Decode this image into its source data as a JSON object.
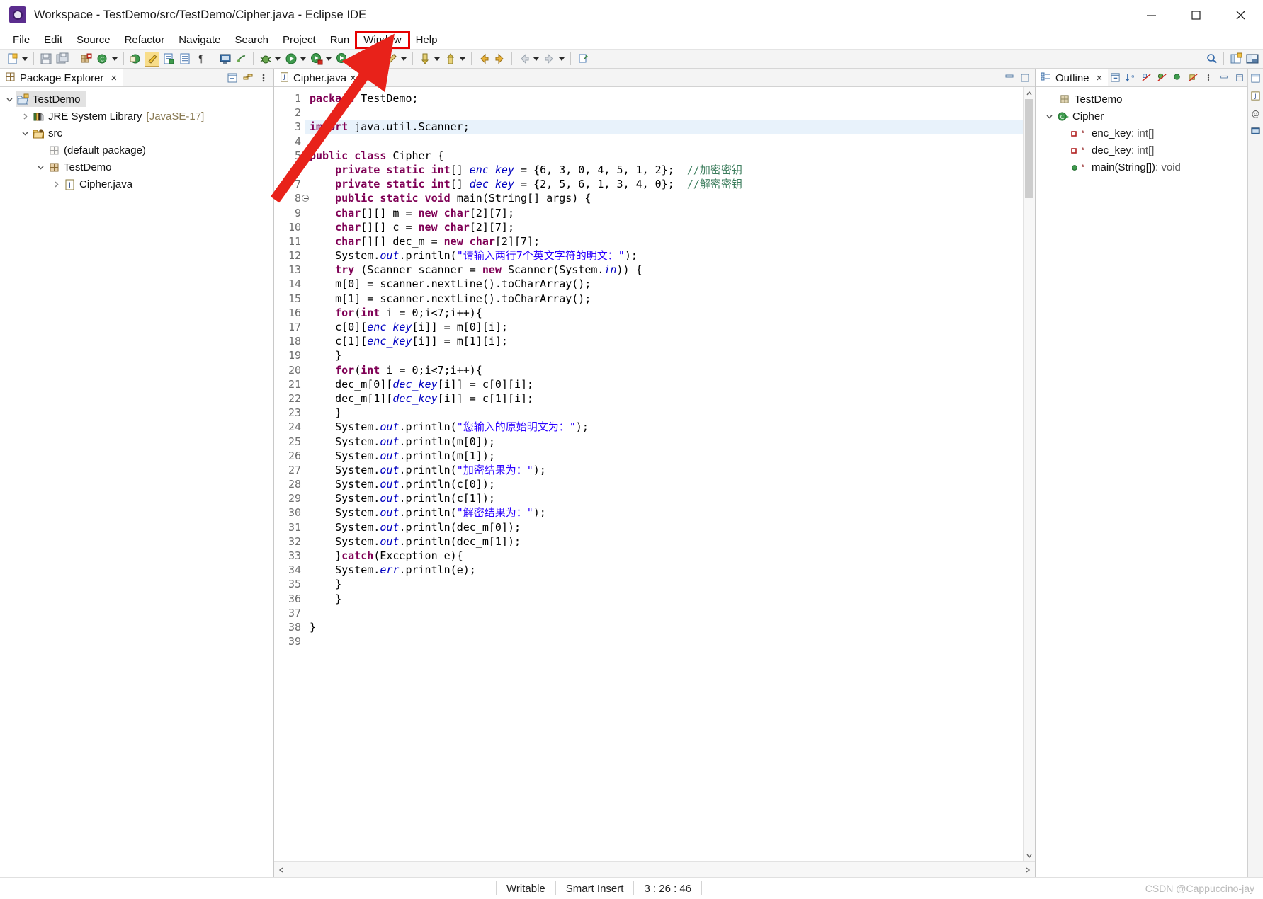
{
  "window": {
    "title": "Workspace - TestDemo/src/TestDemo/Cipher.java - Eclipse IDE",
    "app_icon": "eclipse-icon",
    "minimize": "minimize-button",
    "maximize": "maximize-button",
    "close": "close-button"
  },
  "menubar": {
    "items": [
      {
        "label": "File"
      },
      {
        "label": "Edit"
      },
      {
        "label": "Source"
      },
      {
        "label": "Refactor"
      },
      {
        "label": "Navigate"
      },
      {
        "label": "Search"
      },
      {
        "label": "Project"
      },
      {
        "label": "Run"
      },
      {
        "label": "Window",
        "highlighted": true
      },
      {
        "label": "Help"
      }
    ],
    "highlight_color": "#e60000"
  },
  "package_explorer": {
    "tab_label": "Package Explorer",
    "close_glyph": "×",
    "tree": [
      {
        "label": "TestDemo",
        "icon": "java-project-icon",
        "depth": 0,
        "twisty": "down",
        "selected": true
      },
      {
        "label": "JRE System Library",
        "suffix": "[JavaSE-17]",
        "icon": "library-icon",
        "depth": 1,
        "twisty": "right"
      },
      {
        "label": "src",
        "icon": "source-folder-icon",
        "depth": 1,
        "twisty": "down"
      },
      {
        "label": "(default package)",
        "icon": "package-icon",
        "depth": 2,
        "twisty": "none"
      },
      {
        "label": "TestDemo",
        "icon": "package-icon",
        "depth": 2,
        "twisty": "down"
      },
      {
        "label": "Cipher.java",
        "icon": "java-file-icon",
        "depth": 3,
        "twisty": "right"
      }
    ]
  },
  "editor": {
    "tab_label": "Cipher.java",
    "tab_icon": "java-file-icon",
    "close_glyph": "×",
    "first_line": 1,
    "total_lines": 39,
    "cursor_line": 3,
    "fold_markers": [
      8
    ],
    "lines": [
      {
        "n": 1,
        "tokens": [
          {
            "t": "kw",
            "v": "package"
          },
          {
            "t": "p",
            "v": " TestDemo;"
          }
        ]
      },
      {
        "n": 2,
        "tokens": []
      },
      {
        "n": 3,
        "highlight": true,
        "tokens": [
          {
            "t": "kw",
            "v": "import"
          },
          {
            "t": "p",
            "v": " java.util.Scanner;"
          },
          {
            "t": "caret",
            "v": ""
          }
        ]
      },
      {
        "n": 4,
        "tokens": []
      },
      {
        "n": 5,
        "tokens": [
          {
            "t": "kw",
            "v": "public class"
          },
          {
            "t": "p",
            "v": " Cipher {"
          }
        ]
      },
      {
        "n": 6,
        "tokens": [
          {
            "t": "p",
            "v": "    "
          },
          {
            "t": "kw",
            "v": "private static int"
          },
          {
            "t": "p",
            "v": "[] "
          },
          {
            "t": "fld",
            "v": "enc_key"
          },
          {
            "t": "p",
            "v": " = {6, 3, 0, 4, 5, 1, 2};  "
          },
          {
            "t": "cmt",
            "v": "//加密密钥"
          }
        ]
      },
      {
        "n": 7,
        "tokens": [
          {
            "t": "p",
            "v": "    "
          },
          {
            "t": "kw",
            "v": "private static int"
          },
          {
            "t": "p",
            "v": "[] "
          },
          {
            "t": "fld",
            "v": "dec_key"
          },
          {
            "t": "p",
            "v": " = {2, 5, 6, 1, 3, 4, 0};  "
          },
          {
            "t": "cmt",
            "v": "//解密密钥"
          }
        ]
      },
      {
        "n": 8,
        "tokens": [
          {
            "t": "p",
            "v": "    "
          },
          {
            "t": "kw",
            "v": "public static void"
          },
          {
            "t": "p",
            "v": " main(String[] args) {"
          }
        ]
      },
      {
        "n": 9,
        "tokens": [
          {
            "t": "p",
            "v": "    "
          },
          {
            "t": "kw",
            "v": "char"
          },
          {
            "t": "p",
            "v": "[][] m = "
          },
          {
            "t": "kw",
            "v": "new char"
          },
          {
            "t": "p",
            "v": "[2][7];"
          }
        ]
      },
      {
        "n": 10,
        "tokens": [
          {
            "t": "p",
            "v": "    "
          },
          {
            "t": "kw",
            "v": "char"
          },
          {
            "t": "p",
            "v": "[][] c = "
          },
          {
            "t": "kw",
            "v": "new char"
          },
          {
            "t": "p",
            "v": "[2][7];"
          }
        ]
      },
      {
        "n": 11,
        "tokens": [
          {
            "t": "p",
            "v": "    "
          },
          {
            "t": "kw",
            "v": "char"
          },
          {
            "t": "p",
            "v": "[][] dec_m = "
          },
          {
            "t": "kw",
            "v": "new char"
          },
          {
            "t": "p",
            "v": "[2][7];"
          }
        ]
      },
      {
        "n": 12,
        "tokens": [
          {
            "t": "p",
            "v": "    System."
          },
          {
            "t": "stat",
            "v": "out"
          },
          {
            "t": "p",
            "v": ".println("
          },
          {
            "t": "str",
            "v": "\"请输入两行7个英文字符的明文：\""
          },
          {
            "t": "p",
            "v": ");"
          }
        ]
      },
      {
        "n": 13,
        "tokens": [
          {
            "t": "p",
            "v": "    "
          },
          {
            "t": "kw",
            "v": "try"
          },
          {
            "t": "p",
            "v": " (Scanner scanner = "
          },
          {
            "t": "kw",
            "v": "new"
          },
          {
            "t": "p",
            "v": " Scanner(System."
          },
          {
            "t": "stat",
            "v": "in"
          },
          {
            "t": "p",
            "v": ")) {"
          }
        ]
      },
      {
        "n": 14,
        "tokens": [
          {
            "t": "p",
            "v": "    m[0] = scanner.nextLine().toCharArray();"
          }
        ]
      },
      {
        "n": 15,
        "tokens": [
          {
            "t": "p",
            "v": "    m[1] = scanner.nextLine().toCharArray();"
          }
        ]
      },
      {
        "n": 16,
        "tokens": [
          {
            "t": "p",
            "v": "    "
          },
          {
            "t": "kw",
            "v": "for"
          },
          {
            "t": "p",
            "v": "("
          },
          {
            "t": "kw",
            "v": "int"
          },
          {
            "t": "p",
            "v": " i = 0;i<7;i++){"
          }
        ]
      },
      {
        "n": 17,
        "tokens": [
          {
            "t": "p",
            "v": "    c[0]["
          },
          {
            "t": "fld",
            "v": "enc_key"
          },
          {
            "t": "p",
            "v": "[i]] = m[0][i];"
          }
        ]
      },
      {
        "n": 18,
        "tokens": [
          {
            "t": "p",
            "v": "    c[1]["
          },
          {
            "t": "fld",
            "v": "enc_key"
          },
          {
            "t": "p",
            "v": "[i]] = m[1][i];"
          }
        ]
      },
      {
        "n": 19,
        "tokens": [
          {
            "t": "p",
            "v": "    }"
          }
        ]
      },
      {
        "n": 20,
        "tokens": [
          {
            "t": "p",
            "v": "    "
          },
          {
            "t": "kw",
            "v": "for"
          },
          {
            "t": "p",
            "v": "("
          },
          {
            "t": "kw",
            "v": "int"
          },
          {
            "t": "p",
            "v": " i = 0;i<7;i++){"
          }
        ]
      },
      {
        "n": 21,
        "tokens": [
          {
            "t": "p",
            "v": "    dec_m[0]["
          },
          {
            "t": "fld",
            "v": "dec_key"
          },
          {
            "t": "p",
            "v": "[i]] = c[0][i];"
          }
        ]
      },
      {
        "n": 22,
        "tokens": [
          {
            "t": "p",
            "v": "    dec_m[1]["
          },
          {
            "t": "fld",
            "v": "dec_key"
          },
          {
            "t": "p",
            "v": "[i]] = c[1][i];"
          }
        ]
      },
      {
        "n": 23,
        "tokens": [
          {
            "t": "p",
            "v": "    }"
          }
        ]
      },
      {
        "n": 24,
        "tokens": [
          {
            "t": "p",
            "v": "    System."
          },
          {
            "t": "stat",
            "v": "out"
          },
          {
            "t": "p",
            "v": ".println("
          },
          {
            "t": "str",
            "v": "\"您输入的原始明文为：\""
          },
          {
            "t": "p",
            "v": ");"
          }
        ]
      },
      {
        "n": 25,
        "tokens": [
          {
            "t": "p",
            "v": "    System."
          },
          {
            "t": "stat",
            "v": "out"
          },
          {
            "t": "p",
            "v": ".println(m[0]);"
          }
        ]
      },
      {
        "n": 26,
        "tokens": [
          {
            "t": "p",
            "v": "    System."
          },
          {
            "t": "stat",
            "v": "out"
          },
          {
            "t": "p",
            "v": ".println(m[1]);"
          }
        ]
      },
      {
        "n": 27,
        "tokens": [
          {
            "t": "p",
            "v": "    System."
          },
          {
            "t": "stat",
            "v": "out"
          },
          {
            "t": "p",
            "v": ".println("
          },
          {
            "t": "str",
            "v": "\"加密结果为：\""
          },
          {
            "t": "p",
            "v": ");"
          }
        ]
      },
      {
        "n": 28,
        "tokens": [
          {
            "t": "p",
            "v": "    System."
          },
          {
            "t": "stat",
            "v": "out"
          },
          {
            "t": "p",
            "v": ".println(c[0]);"
          }
        ]
      },
      {
        "n": 29,
        "tokens": [
          {
            "t": "p",
            "v": "    System."
          },
          {
            "t": "stat",
            "v": "out"
          },
          {
            "t": "p",
            "v": ".println(c[1]);"
          }
        ]
      },
      {
        "n": 30,
        "tokens": [
          {
            "t": "p",
            "v": "    System."
          },
          {
            "t": "stat",
            "v": "out"
          },
          {
            "t": "p",
            "v": ".println("
          },
          {
            "t": "str",
            "v": "\"解密结果为：\""
          },
          {
            "t": "p",
            "v": ");"
          }
        ]
      },
      {
        "n": 31,
        "tokens": [
          {
            "t": "p",
            "v": "    System."
          },
          {
            "t": "stat",
            "v": "out"
          },
          {
            "t": "p",
            "v": ".println(dec_m[0]);"
          }
        ]
      },
      {
        "n": 32,
        "tokens": [
          {
            "t": "p",
            "v": "    System."
          },
          {
            "t": "stat",
            "v": "out"
          },
          {
            "t": "p",
            "v": ".println(dec_m[1]);"
          }
        ]
      },
      {
        "n": 33,
        "tokens": [
          {
            "t": "p",
            "v": "    }"
          },
          {
            "t": "kw",
            "v": "catch"
          },
          {
            "t": "p",
            "v": "(Exception e){"
          }
        ]
      },
      {
        "n": 34,
        "tokens": [
          {
            "t": "p",
            "v": "    System."
          },
          {
            "t": "stat",
            "v": "err"
          },
          {
            "t": "p",
            "v": ".println(e);"
          }
        ]
      },
      {
        "n": 35,
        "tokens": [
          {
            "t": "p",
            "v": "    }"
          }
        ]
      },
      {
        "n": 36,
        "tokens": [
          {
            "t": "p",
            "v": "    }"
          }
        ]
      },
      {
        "n": 37,
        "tokens": []
      },
      {
        "n": 38,
        "tokens": [
          {
            "t": "p",
            "v": "}"
          }
        ]
      },
      {
        "n": 39,
        "tokens": []
      }
    ]
  },
  "outline": {
    "tab_label": "Outline",
    "close_glyph": "×",
    "items": [
      {
        "label": "TestDemo",
        "icon": "package-icon",
        "depth": 1,
        "twisty": "none",
        "type": ""
      },
      {
        "label": "Cipher",
        "icon": "class-icon",
        "depth": 0,
        "twisty": "down",
        "type": ""
      },
      {
        "label": "enc_key",
        "icon": "private-static-field-icon",
        "depth": 2,
        "twisty": "none",
        "type": " : int[]"
      },
      {
        "label": "dec_key",
        "icon": "private-static-field-icon",
        "depth": 2,
        "twisty": "none",
        "type": " : int[]"
      },
      {
        "label": "main(String[])",
        "icon": "public-static-method-icon",
        "depth": 2,
        "twisty": "none",
        "type": " : void"
      }
    ]
  },
  "statusbar": {
    "writable": "Writable",
    "insert_mode": "Smart Insert",
    "position": "3 : 26 : 46",
    "watermark": "CSDN @Cappuccino-jay"
  },
  "toolbar": {
    "groups": [
      [
        "new-wizard-icon",
        "save-icon",
        "save-all-icon"
      ],
      [
        "new-java-package-icon",
        "new-java-class-icon"
      ],
      [
        "open-type-icon",
        "toggle-mark-occurrences-icon",
        "open-task-icon",
        "show-whitespace-icon",
        "paragraph-icon"
      ],
      [
        "console-icon",
        "link-icon"
      ],
      [
        "debug-icon",
        "run-icon",
        "run-coverage-icon",
        "external-tools-icon"
      ],
      [
        "open-perspective-icon",
        "search-icon"
      ],
      [
        "next-annotation-icon",
        "previous-annotation-icon",
        "back-icon",
        "forward-icon"
      ],
      [
        "pin-editor-icon"
      ]
    ],
    "right_icons": [
      "search-icon",
      "open-perspective-icon",
      "java-perspective-icon"
    ]
  }
}
